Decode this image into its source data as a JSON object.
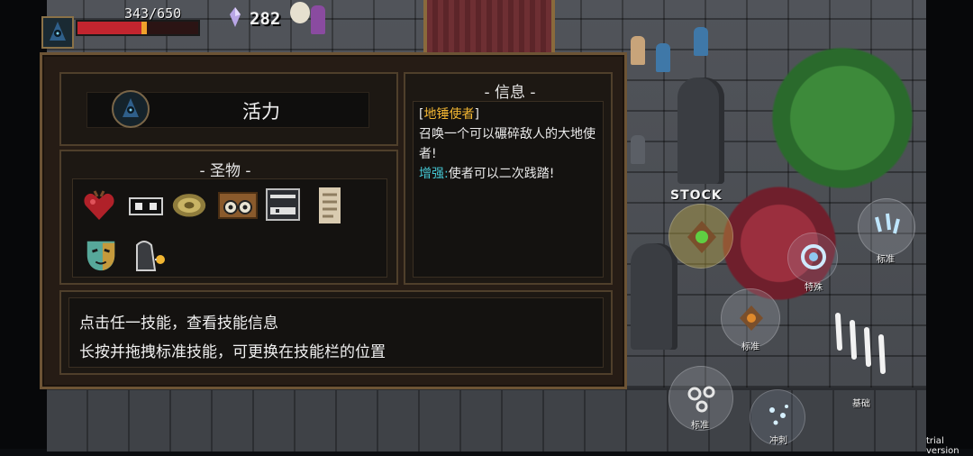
{
  "hud": {
    "hp_text": "343/650",
    "hp_fraction": 0.53,
    "gems": "282",
    "portrait_icon": "hooded-wizard-icon"
  },
  "panel": {
    "class_name": "活力",
    "class_icon": "hooded-wizard-icon",
    "relics_title": "- 圣物 -",
    "relics": [
      "red-heart-relic-icon",
      "black-cassette-relic-icon",
      "golden-disc-relic-icon",
      "wooden-goggles-chest-relic-icon",
      "iron-vault-relic-icon",
      "bone-scroll-relic-icon",
      "green-mask-relic-icon",
      "dark-cloak-lantern-relic-icon"
    ],
    "info_title": "- 信息 -",
    "info": {
      "bracket_open": "[",
      "skill_name": "地锤使者",
      "bracket_close": "]",
      "description": "召唤一个可以碾碎敌人的大地使者!",
      "boost_label": "增强:",
      "boost_text": "使者可以二次践踏!"
    },
    "hints": [
      "点击任一技能，查看技能信息",
      "长按并拖拽标准技能，可更换在技能栏的位置"
    ]
  },
  "skills": {
    "stock_label": "STOCK",
    "standard_top_right": "标准",
    "special": "特殊",
    "standard_mid": "标准",
    "basic": "基础",
    "standard_bottom": "标准",
    "dash": "冲刺"
  },
  "colors": {
    "panel_bg": "#261c15",
    "panel_border": "#6d5435",
    "skill_name": "#f2b632",
    "boost": "#45c7d3",
    "hp": "#c3252f"
  },
  "watermark": "trial version"
}
